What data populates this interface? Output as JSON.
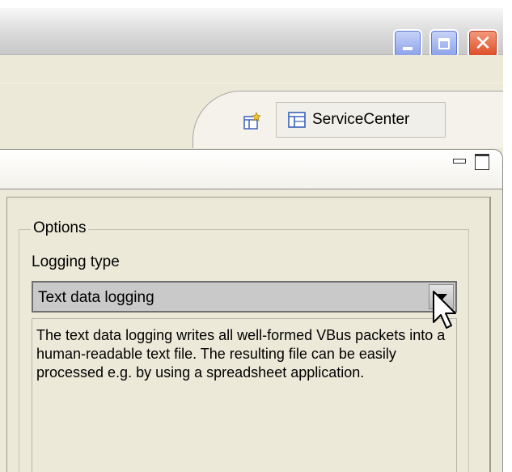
{
  "window": {
    "controls": {
      "minimize_icon": "minimize-icon",
      "maximize_icon": "maximize-icon",
      "close_icon": "close-icon",
      "close_glyph": "✕"
    }
  },
  "toolbar": {
    "open_perspective_icon": "open-perspective-icon",
    "perspective": {
      "label": "ServiceCenter",
      "icon": "perspective-table-icon"
    }
  },
  "view": {
    "minimize_icon": "view-minimize-icon",
    "maximize_icon": "view-maximize-icon"
  },
  "options": {
    "group_title": "Options",
    "logging_type_label": "Logging type",
    "logging_type_value": "Text data logging",
    "description": "The text data logging writes all well-formed VBus packets into a human-readable text file. The resulting file can be easily processed e.g. by using a spreadsheet application."
  },
  "colors": {
    "background": "#ece9d8",
    "close_button": "#dd4a24",
    "window_button": "#8aa0e8",
    "combo_selected": "#c9c9c9"
  }
}
